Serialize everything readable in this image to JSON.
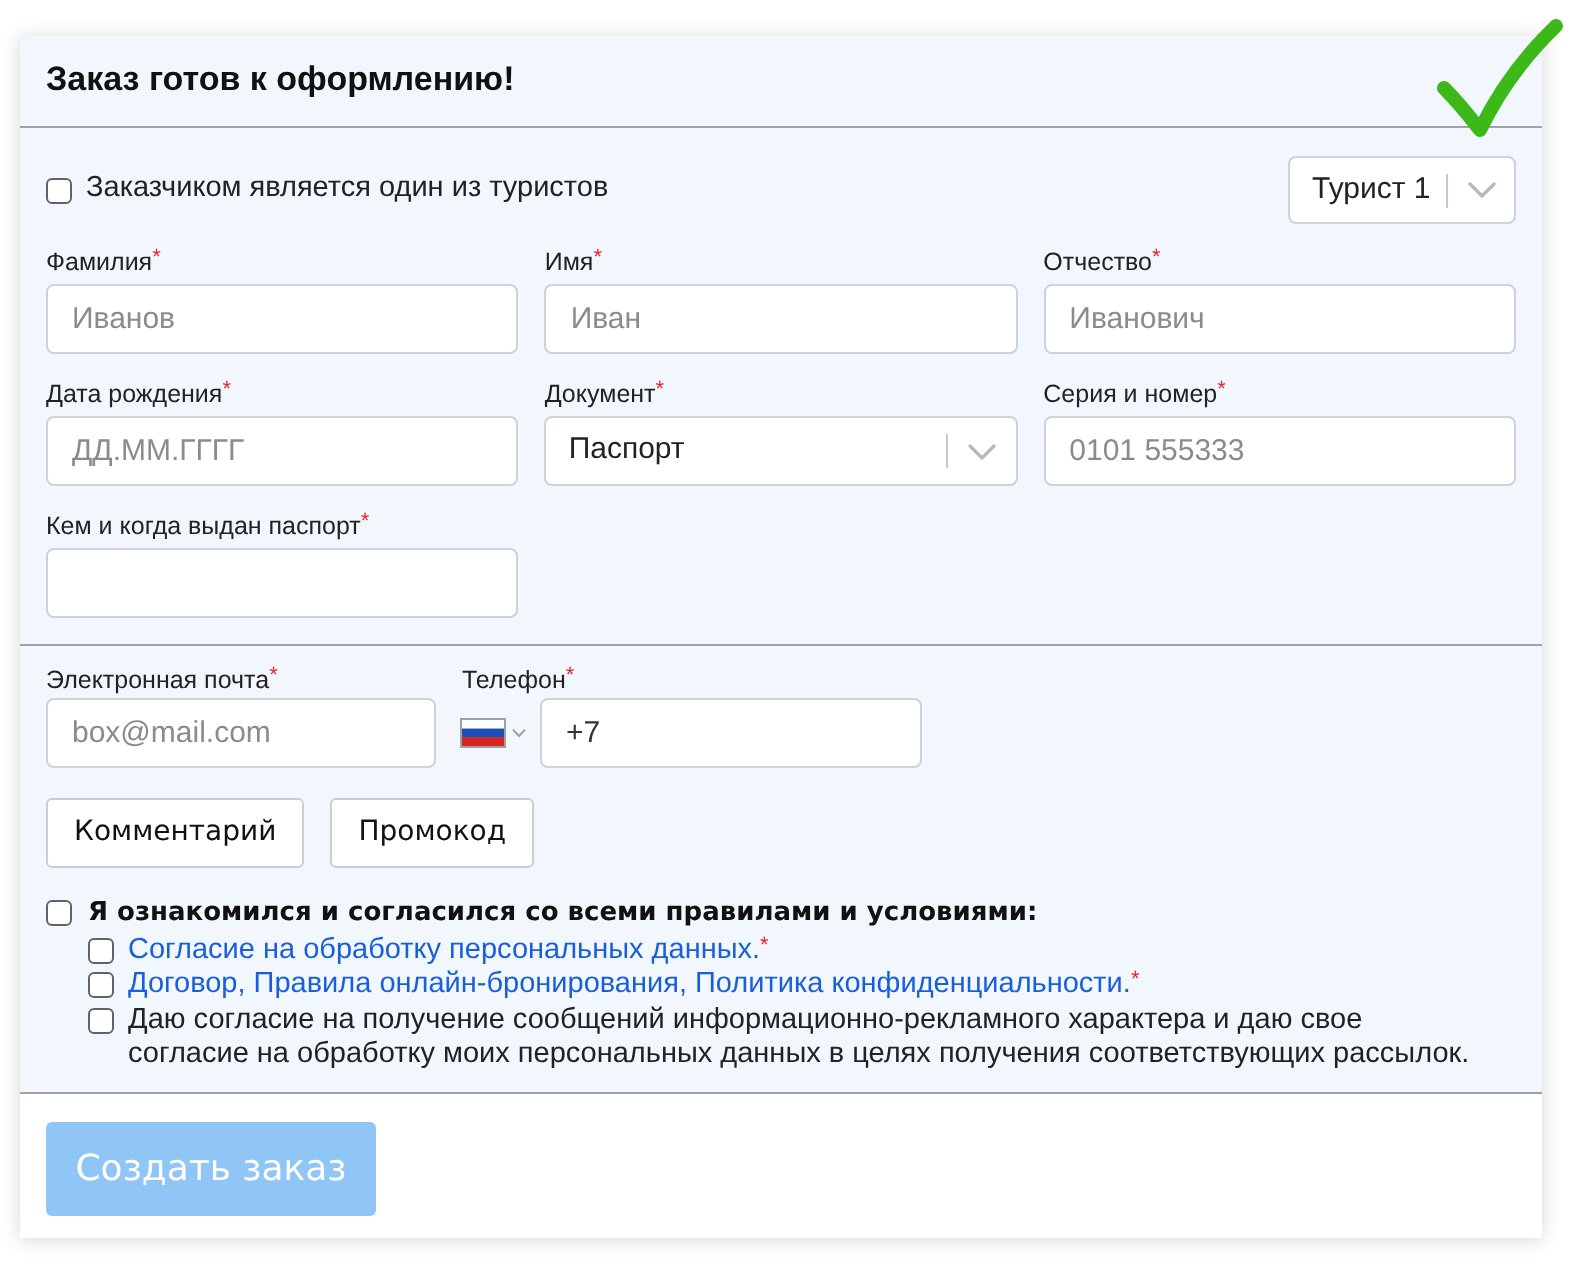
{
  "header": {
    "title": "Заказ готов к оформлению!"
  },
  "customer_option": {
    "label": "Заказчиком является один из туристов",
    "checked": false
  },
  "tourist_select": {
    "value": "Турист 1"
  },
  "passenger_fields": [
    {
      "kind": "text",
      "label": "Фамилия",
      "required_mark": "*",
      "placeholder": "Иванов"
    },
    {
      "kind": "text",
      "label": "Имя",
      "required_mark": "*",
      "placeholder": "Иван"
    },
    {
      "kind": "text",
      "label": "Отчество",
      "required_mark": "*",
      "placeholder": "Иванович"
    },
    {
      "kind": "text",
      "label": "Дата рождения",
      "required_mark": "*",
      "placeholder": "ДД.ММ.ГГГГ"
    },
    {
      "kind": "select",
      "label": "Документ",
      "required_mark": "*",
      "value": "Паспорт"
    },
    {
      "kind": "text",
      "label": "Серия и номер",
      "required_mark": "*",
      "placeholder": "0101 555333"
    },
    {
      "kind": "text",
      "label": "Кем и когда выдан паспорт",
      "required_mark": "*"
    }
  ],
  "contact_fields": [
    {
      "kind": "email",
      "label": "Электронная почта",
      "required_mark": "*",
      "placeholder": "box@mail.com"
    },
    {
      "kind": "phone",
      "label": "Телефон",
      "required_mark": "*",
      "value": "+7"
    }
  ],
  "extra_buttons": [
    "Комментарий",
    "Промокод"
  ],
  "agreement": {
    "label": "Я ознакомился и согласился со всеми правилами и условиями:",
    "checked": false,
    "items": [
      {
        "kind": "links",
        "checked": false,
        "links": [
          "Согласие на обработку персональных данных."
        ],
        "required_mark": "*"
      },
      {
        "kind": "links",
        "checked": false,
        "links": [
          "Договор,",
          "Правила онлайн-бронирования,",
          "Политика конфиденциальности."
        ],
        "required_mark": "*"
      },
      {
        "kind": "text",
        "checked": false,
        "text": "Даю согласие на получение сообщений информационно-рекламного характера и даю свое согласие на обработку моих персональных данных в целях получения соответствующих рассылок."
      }
    ]
  },
  "submit_button": {
    "label": "Создать заказ",
    "disabled": true
  }
}
